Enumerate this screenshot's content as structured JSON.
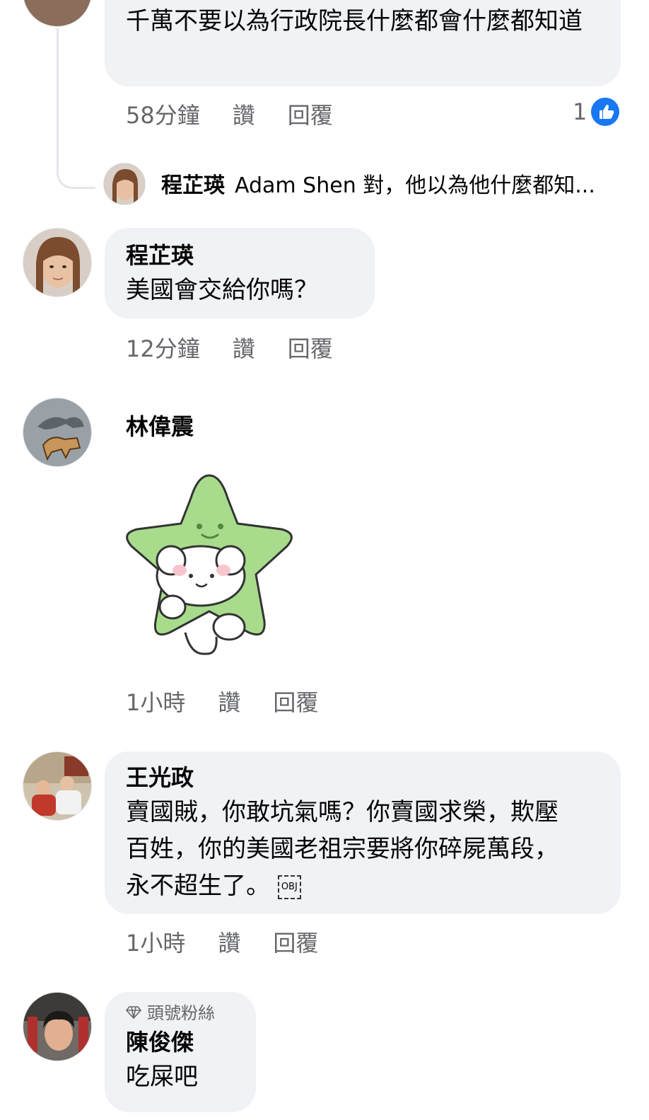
{
  "comment1": {
    "text": "千萬不要以為行政院長什麼都會什麼都知道",
    "time": "58分鐘",
    "like": "讚",
    "reply": "回覆",
    "reaction_count": "1"
  },
  "reply_preview": {
    "name": "程芷瑛",
    "text": "Adam Shen 對，他以為他什麼都知..."
  },
  "comment2": {
    "name": "程芷瑛",
    "text": "美國會交給你嗎？",
    "time": "12分鐘",
    "like": "讚",
    "reply": "回覆"
  },
  "comment3": {
    "name": "林偉震",
    "time": "1小時",
    "like": "讚",
    "reply": "回覆"
  },
  "comment4": {
    "name": "王光政",
    "text": "賣國賊，你敢坑氣嗎？你賣國求榮，欺壓百姓，你的美國老祖宗要將你碎屍萬段，永不超生了。",
    "obj": "OBJ",
    "time": "1小時",
    "like": "讚",
    "reply": "回覆"
  },
  "comment5": {
    "badge": "頭號粉絲",
    "name": "陳俊傑",
    "text": "吃屎吧"
  },
  "colors": {
    "bubble": "#f0f2f5",
    "meta_text": "#65676b",
    "like_blue": "#1877f2",
    "sticker_green": "#a8dc8c"
  }
}
